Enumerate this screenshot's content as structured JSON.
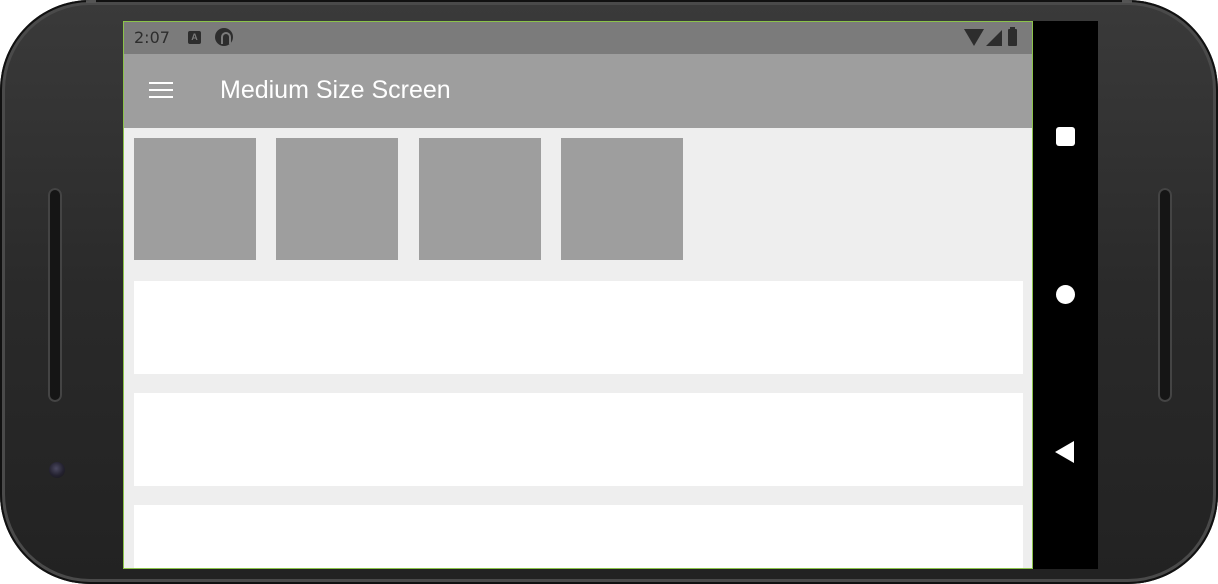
{
  "status_bar": {
    "time": "2:07",
    "notification_icons": [
      "a-box-icon",
      "p-circle-icon"
    ],
    "system_icons": [
      "wifi-icon",
      "signal-icon",
      "battery-icon"
    ]
  },
  "app_bar": {
    "menu_icon": "menu-icon",
    "title": "Medium Size Screen"
  },
  "tiles": [
    {
      "name": "tile-1"
    },
    {
      "name": "tile-2"
    },
    {
      "name": "tile-3"
    },
    {
      "name": "tile-4"
    }
  ],
  "cards": [
    {
      "name": "card-1"
    },
    {
      "name": "card-2"
    },
    {
      "name": "card-3"
    }
  ],
  "navigation": {
    "buttons": [
      "recent-apps-icon",
      "home-icon",
      "back-icon"
    ]
  },
  "colors": {
    "status_bar": "#7b7b7b",
    "app_bar": "#9e9e9e",
    "background": "#eeeeee",
    "tile": "#9e9e9e",
    "card": "#ffffff",
    "nav_bar": "#000000",
    "screen_border": "#8bc34a"
  }
}
